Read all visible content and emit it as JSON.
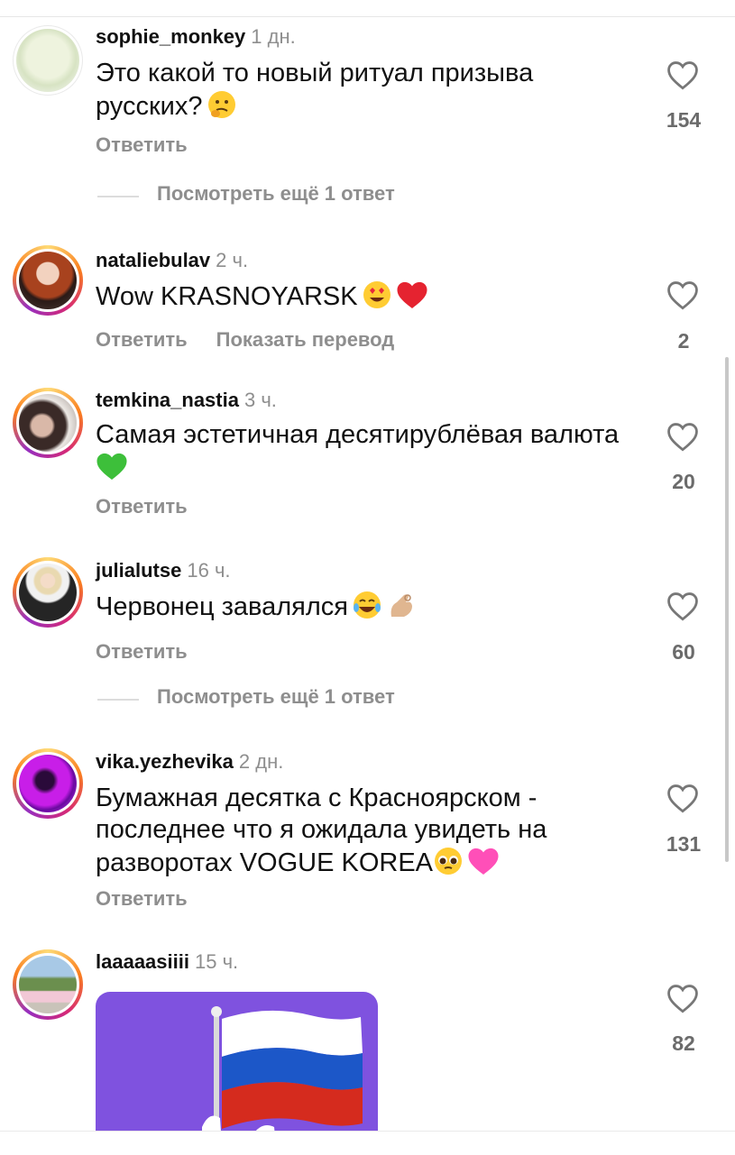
{
  "comments": [
    {
      "username": "sophie_monkey",
      "time": "1 дн.",
      "text": "Это какой то новый ритуал призыва русских?",
      "emoji": "thinking-emoji",
      "likes": "154",
      "actions": [
        "Ответить"
      ],
      "replies_link": "Посмотреть ещё 1 ответ"
    },
    {
      "username": "nataliebulav",
      "time": "2 ч.",
      "text": "Wow KRASNOYARSK",
      "emoji": "heart-eyes-and-red-heart-emoji",
      "likes": "2",
      "actions": [
        "Ответить",
        "Показать перевод"
      ]
    },
    {
      "username": "temkina_nastia",
      "time": "3 ч.",
      "text": "Самая эстетичная десятирублёвая валюта",
      "emoji": "green-heart-emoji",
      "likes": "20",
      "actions": [
        "Ответить"
      ]
    },
    {
      "username": "julialutse",
      "time": "16 ч.",
      "text": "Червонец завалялся",
      "emoji": "laughing-and-pinch-emoji",
      "likes": "60",
      "actions": [
        "Ответить"
      ],
      "replies_link": "Посмотреть ещё 1 ответ"
    },
    {
      "username": "vika.yezhevika",
      "time": "2 дн.",
      "text": "Бумажная десятка с Красноярском - последнее что я ожидала увидеть на разворотах VOGUE KOREA",
      "emoji": "pleading-and-pink-heart-emoji",
      "likes": "131",
      "actions": [
        "Ответить"
      ]
    },
    {
      "username": "laaaaasiiii",
      "time": "15 ч.",
      "text": "",
      "emoji": "russian-flag-sticker",
      "likes": "82",
      "actions": []
    }
  ],
  "colors": {
    "muted": "#8e8e8e",
    "sticker_bg": "#7f52df",
    "flag_white": "#ffffff",
    "flag_blue": "#1c57c8",
    "flag_red": "#d52b1e"
  }
}
